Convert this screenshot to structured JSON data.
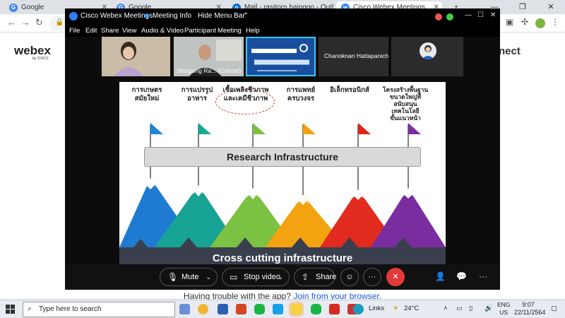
{
  "browser": {
    "tabs": [
      {
        "label": "Google",
        "color": "#4285f4",
        "glyph": "G"
      },
      {
        "label": "Google",
        "color": "#4285f4",
        "glyph": "G"
      },
      {
        "label": "Mail - rasitorn hainggo - Outlook",
        "color": "#0a6ed1",
        "glyph": "o"
      },
      {
        "label": "Cisco Webex Meetings",
        "color": "#2d7ff9",
        "glyph": "w"
      }
    ],
    "new_tab": "+"
  },
  "page": {
    "brand": "webex",
    "brand_sub": "by CISCO",
    "connect_text": "nect",
    "trouble_text": "Having trouble with the app?",
    "trouble_link": "Join from your browser."
  },
  "webex": {
    "title": "Cisco Webex Meetings",
    "meeting_info": "Meeting Info",
    "hide_menu": "Hide Menu Bar",
    "hide_menu_caret": "⌃",
    "menu": [
      "File",
      "Edit",
      "Share",
      "View",
      "Audio & Video",
      "Participant",
      "Meeting",
      "Help"
    ],
    "participants": [
      {
        "name": ""
      },
      {
        "name": "Sittapong Ra... (Cohost)"
      },
      {
        "name": ""
      },
      {
        "name": "Chanoknan Hattapanichaporn"
      },
      {
        "name": ""
      }
    ],
    "controls": {
      "mute": "Mute",
      "stop_video": "Stop video",
      "share": "Share",
      "end_icon": "✕",
      "more": "···"
    }
  },
  "slide": {
    "topics": [
      "การเกษตร\nสมัยใหม่",
      "การแปรรูป\nอาหาร",
      "เชื้อเพลิงชีวภาพ\nและเคมีชีวภาพ",
      "การแพทย์\nครบวงจร",
      "อิเล็กทรอนิกส์",
      "โครงสร้างพื้นฐาน\nขนาดใหญ่ที่\nสนับสนุน\nเทคโนโลยี\nขั้นแนวหน้า"
    ],
    "flag_colors": [
      "#1e88d8",
      "#17a89a",
      "#7cc242",
      "#f2a10e",
      "#e0231b",
      "#7b2fa0"
    ],
    "research_infra": "Research Infrastructure",
    "mountains": [
      {
        "color": "#1f7bd1"
      },
      {
        "color": "#16a394"
      },
      {
        "color": "#7bc142"
      },
      {
        "color": "#f3a30f"
      },
      {
        "color": "#e02b1e"
      },
      {
        "color": "#7a2d9f"
      }
    ],
    "cross_cutting": "Cross cutting infrastructure"
  },
  "taskbar": {
    "search_placeholder": "Type here to search",
    "links": "Links",
    "weather": "24°C",
    "lang_top": "ENG",
    "lang_bottom": "US",
    "time": "9:07",
    "date": "22/11/2564"
  }
}
